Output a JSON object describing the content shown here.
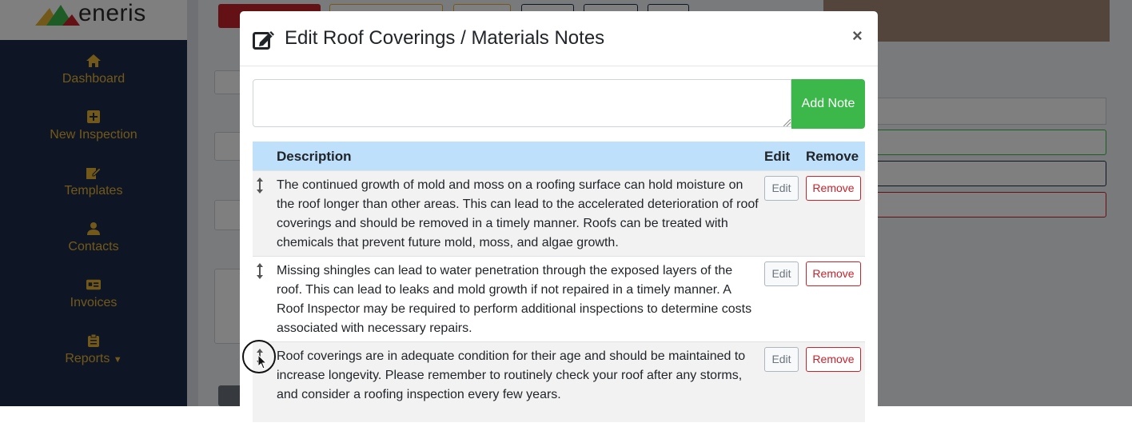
{
  "app": {
    "logo_text": "eneris",
    "nav": [
      {
        "label": "Dashboard",
        "icon": "home-icon"
      },
      {
        "label": "New Inspection",
        "icon": "plus-square-icon"
      },
      {
        "label": "Templates",
        "icon": "edit-document-icon"
      },
      {
        "label": "Contacts",
        "icon": "user-icon"
      },
      {
        "label": "Invoices",
        "icon": "id-card-icon"
      },
      {
        "label": "Reports",
        "icon": "clipboard-icon"
      }
    ]
  },
  "modal": {
    "title": "Edit Roof Coverings / Materials Notes",
    "close_label": "×",
    "note_input": {
      "value": "",
      "placeholder": ""
    },
    "add_button": "Add Note",
    "table": {
      "headers": {
        "description": "Description",
        "edit": "Edit",
        "remove": "Remove"
      },
      "rows": [
        {
          "description": "The continued growth of mold and moss on a roofing surface can hold moisture on the roof longer than other areas. This can lead to the accelerated deterioration of roof coverings and should be removed in a timely manner. Roofs can be treated with chemicals that prevent future mold, moss, and algae growth.",
          "edit": "Edit",
          "remove": "Remove"
        },
        {
          "description": "Missing shingles can lead to water penetration through the exposed layers of the roof. This can lead to leaks and mold growth if not repaired in a timely manner. A Roof Inspector may be required to perform additional inspections to determine costs associated with necessary repairs.",
          "edit": "Edit",
          "remove": "Remove"
        },
        {
          "description": "Roof coverings are in adequate condition for their age and should be maintained to increase longevity. Please remember to routinely check your roof after any storms, and consider a roofing inspection every few years.",
          "edit": "Edit",
          "remove": "Remove"
        }
      ]
    }
  },
  "colors": {
    "sidebar": "#1c2a4a",
    "nav_accent": "#e7b332",
    "header_row": "#bee0fb",
    "add_button": "#3cb84a",
    "remove_button": "#c8232c"
  }
}
